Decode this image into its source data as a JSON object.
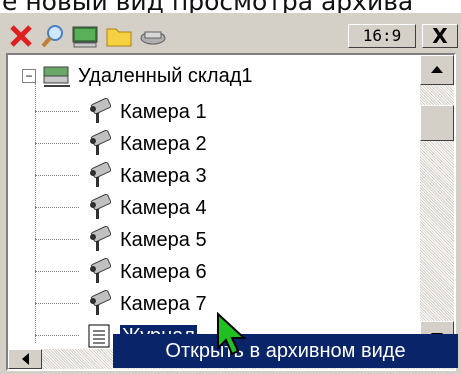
{
  "heading": "е новый вид просмотра архива",
  "toolbar": {
    "buttons": [
      {
        "icon": "close-red-x-icon"
      },
      {
        "icon": "magnifier-icon"
      },
      {
        "icon": "monitor-icon"
      },
      {
        "icon": "folder-icon"
      },
      {
        "icon": "device-icon"
      }
    ],
    "ratio_label": "16:9",
    "close_label": "X"
  },
  "tree": {
    "root": {
      "label": "Удаленный склад1",
      "icon": "server-icon",
      "expander": "−"
    },
    "cameras": [
      {
        "label": "Камера 1",
        "icon": "camera-icon"
      },
      {
        "label": "Камера 2",
        "icon": "camera-icon"
      },
      {
        "label": "Камера 3",
        "icon": "camera-icon"
      },
      {
        "label": "Камера 4",
        "icon": "camera-icon"
      },
      {
        "label": "Камера 5",
        "icon": "camera-icon"
      },
      {
        "label": "Камера 6",
        "icon": "camera-icon"
      },
      {
        "label": "Камера 7",
        "icon": "camera-icon"
      }
    ],
    "journal": {
      "label": "Журнал",
      "icon": "journal-icon",
      "selected": true
    }
  },
  "context_menu": {
    "items": [
      {
        "label": "Открыть в архивном виде"
      }
    ]
  },
  "colors": {
    "selection": "#0a246a",
    "window": "#d4d0c8",
    "accent_red": "#e02020"
  }
}
